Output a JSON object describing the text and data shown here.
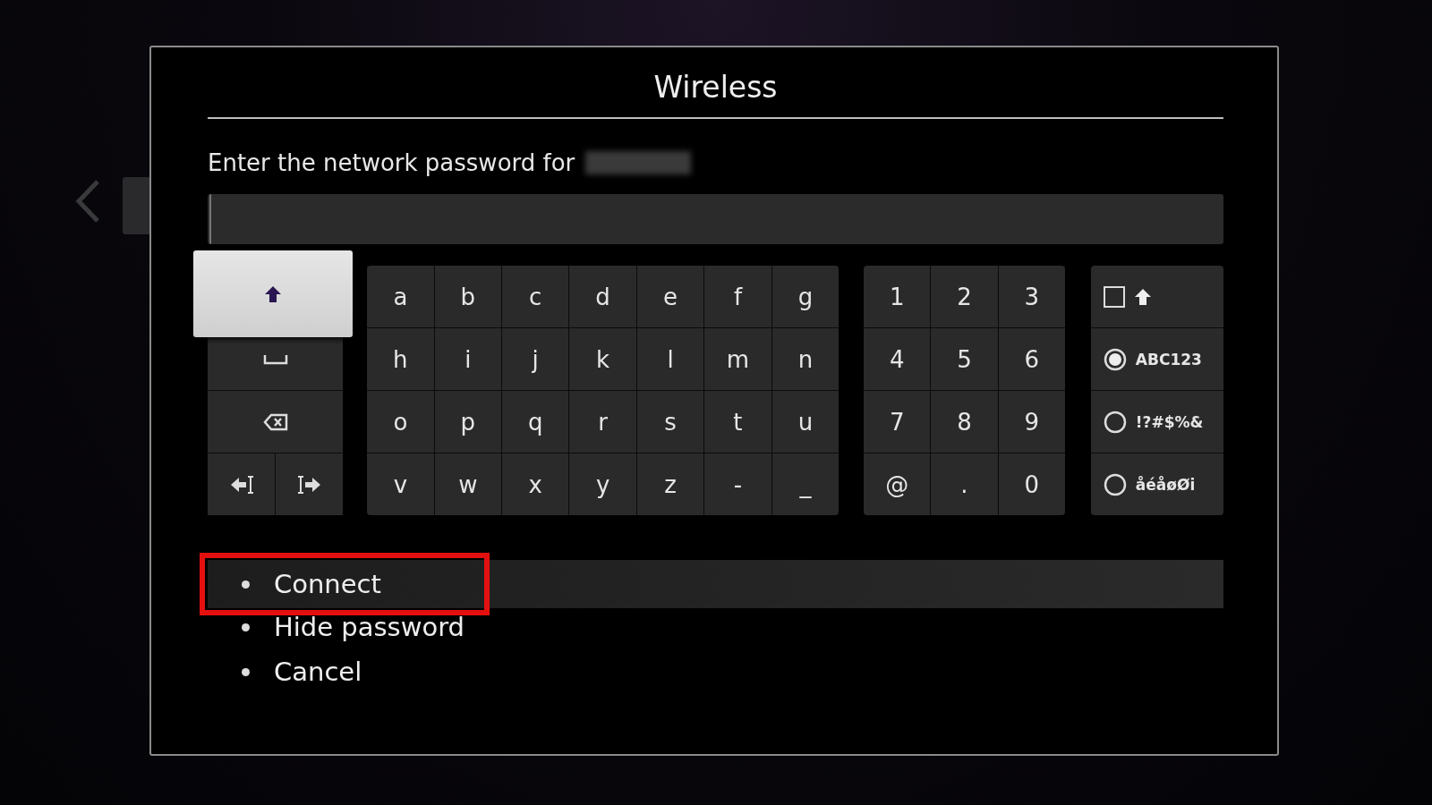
{
  "dialog": {
    "title": "Wireless",
    "prompt": "Enter the network password for",
    "network_name_redacted": true
  },
  "keyboard": {
    "left_keys": [
      [
        {
          "kind": "shift",
          "focused": true
        }
      ],
      [
        {
          "kind": "space",
          "focused": false
        }
      ],
      [
        {
          "kind": "backspace",
          "focused": false
        }
      ],
      [
        {
          "kind": "cursor_left",
          "focused": false
        },
        {
          "kind": "cursor_right",
          "focused": false
        }
      ]
    ],
    "letters": [
      [
        "a",
        "b",
        "c",
        "d",
        "e",
        "f",
        "g"
      ],
      [
        "h",
        "i",
        "j",
        "k",
        "l",
        "m",
        "n"
      ],
      [
        "o",
        "p",
        "q",
        "r",
        "s",
        "t",
        "u"
      ],
      [
        "v",
        "w",
        "x",
        "y",
        "z",
        "-",
        "_"
      ]
    ],
    "numbers": [
      [
        "1",
        "2",
        "3"
      ],
      [
        "4",
        "5",
        "6"
      ],
      [
        "7",
        "8",
        "9"
      ],
      [
        "@",
        ".",
        "0"
      ]
    ],
    "modes": [
      {
        "kind": "checkbox",
        "checked": false
      },
      {
        "kind": "radio",
        "label": "ABC123",
        "selected": true
      },
      {
        "kind": "radio",
        "label": "!?#$%&",
        "selected": false
      },
      {
        "kind": "radio",
        "label": "åéåøØi",
        "selected": false
      }
    ]
  },
  "menu": [
    {
      "label": "Connect",
      "selected": true
    },
    {
      "label": "Hide password",
      "selected": false
    },
    {
      "label": "Cancel",
      "selected": false
    }
  ]
}
